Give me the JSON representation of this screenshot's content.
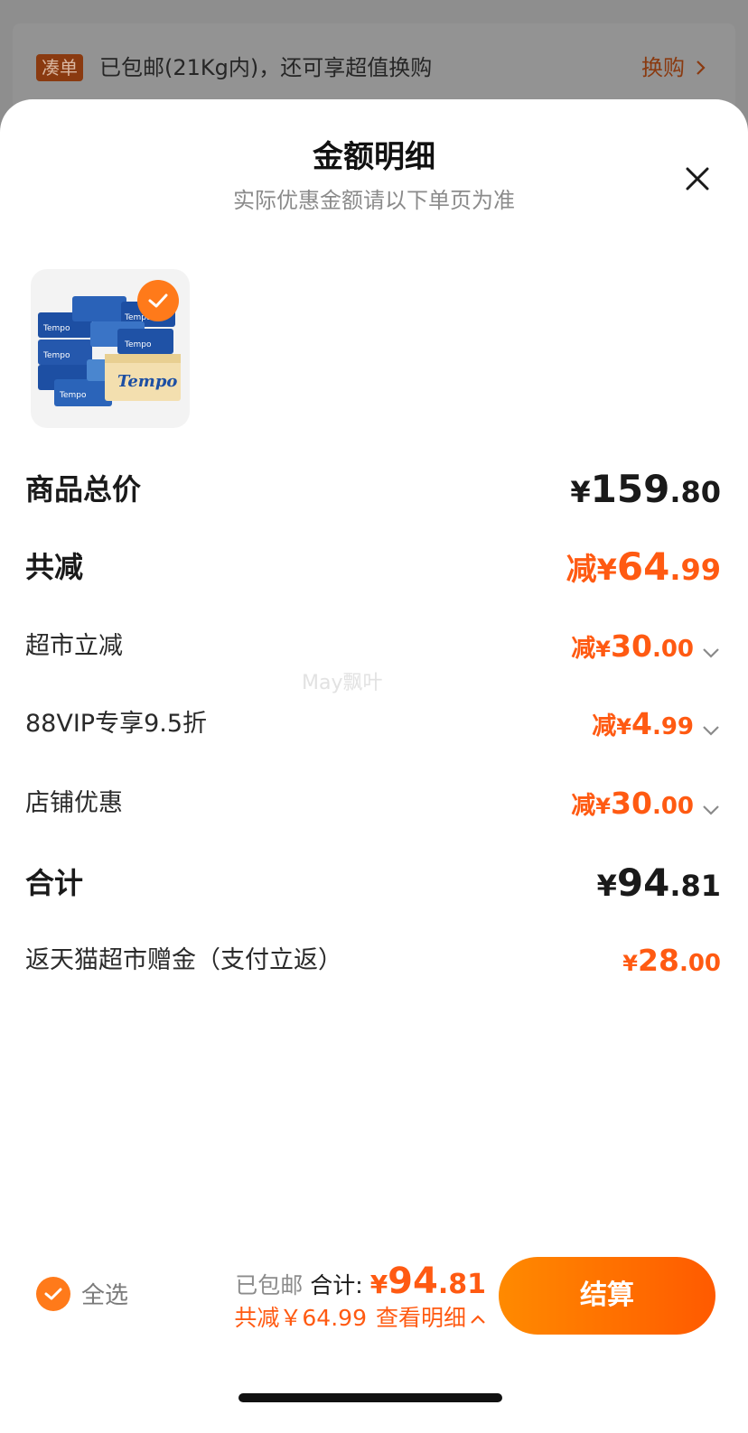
{
  "banner": {
    "tag": "凑单",
    "text": "已包邮(21Kg内)，还可享超值换购",
    "link": "换购"
  },
  "sheet": {
    "title": "金额明细",
    "subtitle": "实际优惠金额请以下单页为准"
  },
  "product": {
    "icon": "tissue-box-product-image",
    "selected": true
  },
  "rows": {
    "subtotal": {
      "label": "商品总价",
      "yen": "¥",
      "int": "159",
      "dec": ".80"
    },
    "total_discount": {
      "label": "共减",
      "prefix": "减",
      "yen": "¥",
      "int": "64",
      "dec": ".99"
    },
    "supermarket": {
      "label": "超市立减",
      "prefix": "减",
      "yen": "¥",
      "int": "30",
      "dec": ".00"
    },
    "vip": {
      "label": "88VIP专享9.5折",
      "prefix": "减",
      "yen": "¥",
      "int": "4",
      "dec": ".99"
    },
    "store": {
      "label": "店铺优惠",
      "prefix": "减",
      "yen": "¥",
      "int": "30",
      "dec": ".00"
    },
    "sum": {
      "label": "合计",
      "yen": "¥",
      "int": "94",
      "dec": ".81"
    },
    "cashback": {
      "label": "返天猫超市赠金（支付立返）",
      "yen": "¥",
      "int": "28",
      "dec": ".00"
    }
  },
  "watermark": "May飘叶",
  "bottom": {
    "select_all": "全选",
    "shipping": "已包邮",
    "total_label": "合计:",
    "total_yen": "¥",
    "total_int": "94",
    "total_dec": ".81",
    "discount": "共减￥64.99",
    "view_detail": "查看明细",
    "checkout": "结算"
  },
  "colors": {
    "accent": "#ff5a12",
    "button_start": "#ff8a00",
    "button_end": "#ff5a00",
    "overlay": "#8e8e8e"
  }
}
